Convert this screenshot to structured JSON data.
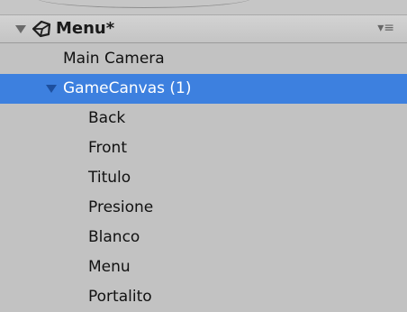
{
  "hierarchy": {
    "scene": {
      "title": "Menu*",
      "icon": "unity-scene-icon",
      "options_icon": "▾≡"
    },
    "objects": [
      {
        "label": "Main Camera",
        "depth": 0,
        "selected": false,
        "expandable": false
      },
      {
        "label": "GameCanvas (1)",
        "depth": 0,
        "selected": true,
        "expandable": true,
        "expanded": true
      },
      {
        "label": "Back",
        "depth": 1,
        "selected": false,
        "expandable": false
      },
      {
        "label": "Front",
        "depth": 1,
        "selected": false,
        "expandable": false
      },
      {
        "label": "Titulo",
        "depth": 1,
        "selected": false,
        "expandable": false
      },
      {
        "label": "Presione",
        "depth": 1,
        "selected": false,
        "expandable": false
      },
      {
        "label": "Blanco",
        "depth": 1,
        "selected": false,
        "expandable": false
      },
      {
        "label": "Menu",
        "depth": 1,
        "selected": false,
        "expandable": false
      },
      {
        "label": "Portalito",
        "depth": 1,
        "selected": false,
        "expandable": false
      }
    ]
  },
  "colors": {
    "panel_bg": "#c2c2c2",
    "selection": "#3d80df",
    "selected_text": "#ffffff",
    "text": "#111111"
  }
}
